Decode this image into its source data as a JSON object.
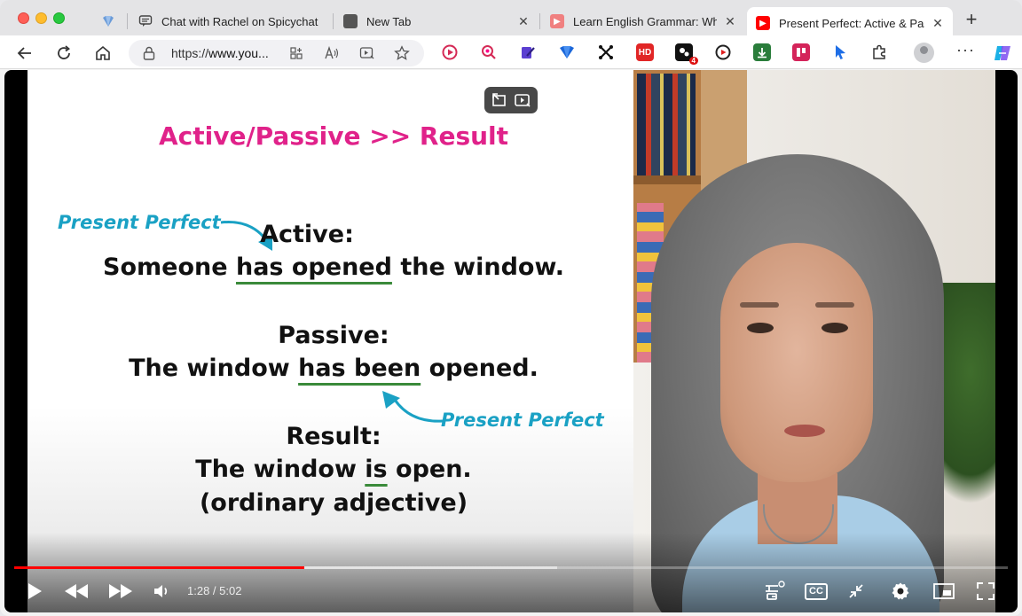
{
  "tabs": [
    {
      "title": ""
    },
    {
      "title": "Chat with Rachel on Spicychat"
    },
    {
      "title": "New Tab"
    },
    {
      "title": "Learn English Grammar: When"
    },
    {
      "title": "Present Perfect: Active & Passive"
    }
  ],
  "address_bar": {
    "url_prefix": "https://",
    "url_host": "www.you..."
  },
  "extensions": {
    "badge_count": "4",
    "hd_label": "HD"
  },
  "slide": {
    "title": "Active/Passive >> Result",
    "active_heading": "Active:",
    "active_pre": "Someone ",
    "active_verb": "has opened",
    "active_post": " the window.",
    "passive_heading": "Passive:",
    "passive_pre": "The window ",
    "passive_verb": "has been",
    "passive_post": " opened.",
    "result_heading": "Result:",
    "result_pre": "The window ",
    "result_verb": "is",
    "result_post": " open.",
    "result_note": "(ordinary adjective)",
    "present_perfect_label_1": "Present Perfect",
    "present_perfect_label_2": "Present Perfect"
  },
  "player": {
    "time": "1:28 / 5:02",
    "played_fraction": 0.292,
    "buffered_fraction": 0.546,
    "cc_label": "CC"
  }
}
